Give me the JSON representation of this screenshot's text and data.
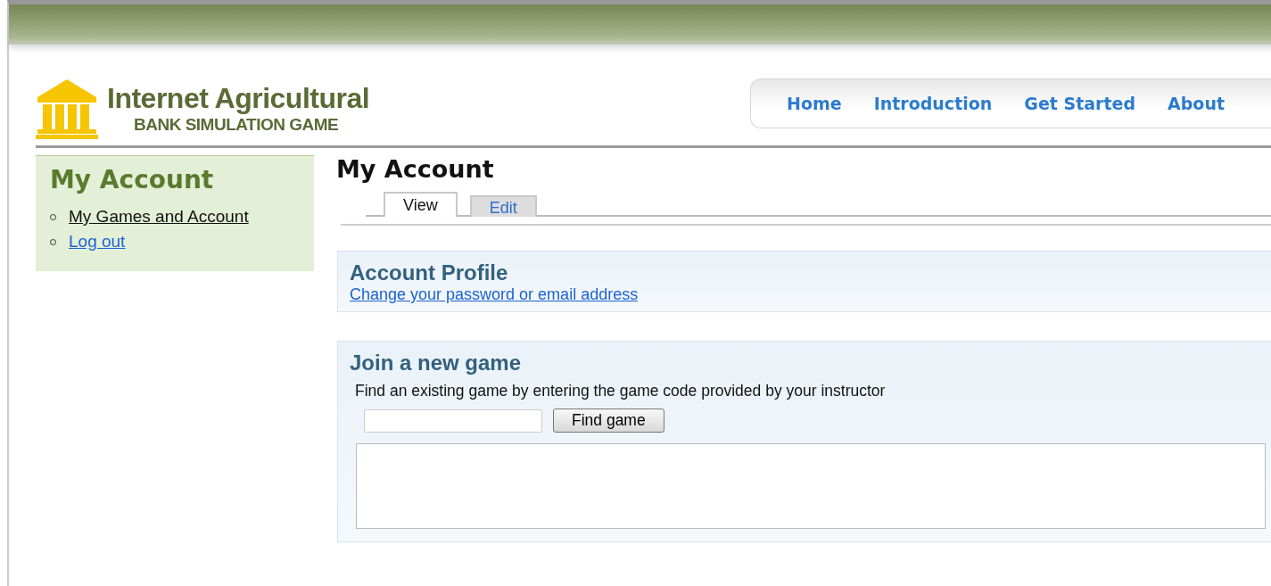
{
  "logo": {
    "title": "Internet Agricultural",
    "subtitle": "BANK SIMULATION GAME"
  },
  "nav": [
    {
      "label": "Home"
    },
    {
      "label": "Introduction"
    },
    {
      "label": "Get Started"
    },
    {
      "label": "About"
    }
  ],
  "sidebar": {
    "title": "My Account",
    "items": [
      {
        "label": "My Games and Account",
        "selected": true
      },
      {
        "label": "Log out",
        "selected": false
      }
    ]
  },
  "page_title": "My Account",
  "tabs": [
    {
      "label": "View",
      "selected": true
    },
    {
      "label": "Edit",
      "selected": false
    }
  ],
  "account_profile": {
    "title": "Account Profile",
    "link": "Change your password or email address"
  },
  "join_game": {
    "title": "Join a new game",
    "description": "Find an existing game by entering the game code provided by your instructor",
    "button": "Find game"
  }
}
